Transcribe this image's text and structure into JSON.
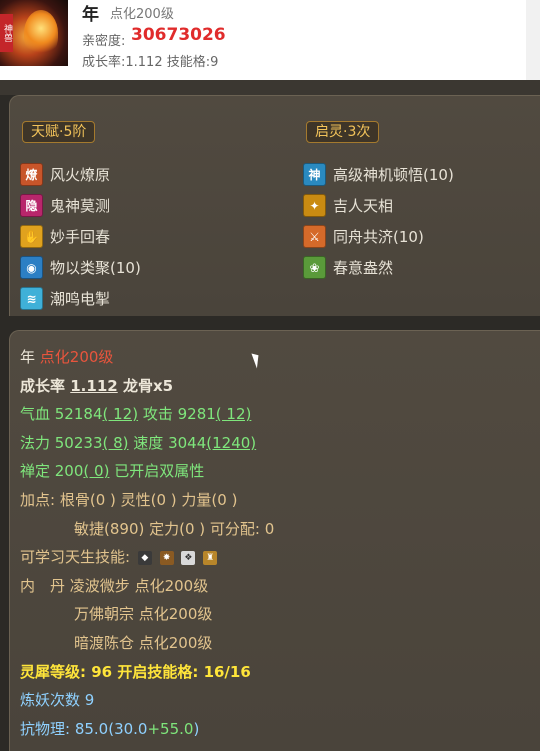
{
  "header": {
    "avatar_tag": "神兽",
    "name": "年",
    "level": "点化200级",
    "intimacy_label": "亲密度:",
    "intimacy_value": "30673026",
    "growth_line": "成长率:1.112 技能格:9"
  },
  "talent": {
    "title": "天赋·5阶",
    "skills": [
      {
        "label": "风火燎原",
        "icon": "fire-icon",
        "glyph": "燎",
        "color": "#c8552a"
      },
      {
        "label": "鬼神莫测",
        "icon": "hidden-icon",
        "glyph": "隐",
        "color": "#b8266b"
      },
      {
        "label": "妙手回春",
        "icon": "heal-icon",
        "glyph": "✋",
        "color": "#e0a21e"
      },
      {
        "label": "物以类聚(10)",
        "icon": "orb-icon",
        "glyph": "◉",
        "color": "#2c7fc4"
      },
      {
        "label": "潮鸣电掣",
        "icon": "lightning-icon",
        "glyph": "≋",
        "color": "#3fb0d8"
      }
    ]
  },
  "awaken": {
    "title": "启灵·3次",
    "skills": [
      {
        "label": "高级神机顿悟(10)",
        "icon": "insight-icon",
        "glyph": "神",
        "color": "#2a8ac0"
      },
      {
        "label": "吉人天相",
        "icon": "fortune-icon",
        "glyph": "✦",
        "color": "#c98b12"
      },
      {
        "label": "同舟共济(10)",
        "icon": "boat-icon",
        "glyph": "⚔",
        "color": "#d56a2a"
      },
      {
        "label": "春意盎然",
        "icon": "spring-icon",
        "glyph": "❀",
        "color": "#5a9a3a"
      }
    ]
  },
  "stats": {
    "name": "年",
    "level": "点化200级",
    "growth_label": "成长率",
    "growth_value": "1.112",
    "dragon_bone": "龙骨x5",
    "hp": "气血 52184",
    "hp_bonus": "( 12)",
    "attack": "攻击 9281",
    "attack_bonus": "( 12)",
    "mp": "法力 50233",
    "mp_bonus": "( 8)",
    "speed": "速度 3044",
    "speed_bonus": "(1240)",
    "zen": "禅定 200",
    "zen_bonus": "( 0)",
    "dual_attr": "已开启双属性",
    "points_label": "加点:",
    "points_line1": "根骨(0 ) 灵性(0 ) 力量(0 )",
    "points_line2": "敏捷(890) 定力(0 ) 可分配: 0",
    "learnable_label": "可学习天生技能:",
    "learnable_icons": [
      "◆",
      "✸",
      "❖",
      "♜"
    ],
    "inner_label": "内　丹",
    "inner_1": "凌波微步 点化200级",
    "inner_2": "万佛朝宗 点化200级",
    "inner_3": "暗渡陈仓 点化200级",
    "spirit_label": "灵犀等级: ",
    "spirit_value": "96",
    "slots_label": " 开启技能格: ",
    "slots_value": "16/16",
    "refine": "炼妖次数 9",
    "resist_label": "抗物理: ",
    "resist_value": "85.0(30.0",
    "resist_plus": "+55.0",
    "resist_close": ")"
  },
  "colors": {
    "intimacy": "#e02b2b",
    "section_title": "#f2c35a",
    "green_stat": "#7fe67c",
    "spirit": "#ffe53a"
  }
}
